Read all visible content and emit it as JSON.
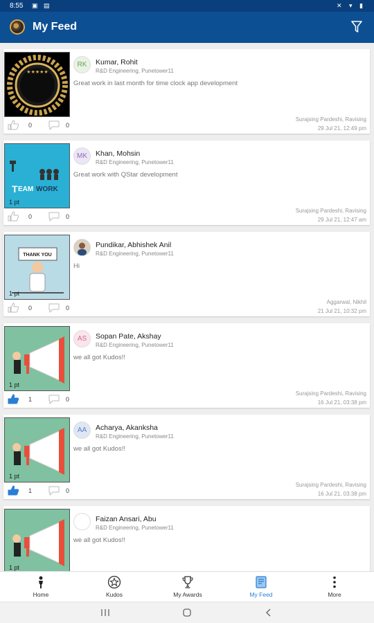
{
  "status_bar": {
    "time": "8:55"
  },
  "app_bar": {
    "title": "My Feed"
  },
  "feed": [
    {
      "points": "",
      "initials": "RK",
      "avatar_bg": "#e9f3e4",
      "avatar_fg": "#6aa05a",
      "name": "Kumar, Rohit",
      "dept": "R&D Engineering, Punetower11",
      "message": "Great work in last month for time clock app development",
      "giver": "Surajsing Pardeshi, Ravising",
      "date": "29 Jul 21, 12:49 pm",
      "likes": "0",
      "comments": "0",
      "liked": false,
      "image": "medal"
    },
    {
      "points": "1 pt",
      "initials": "MK",
      "avatar_bg": "#ece6f5",
      "avatar_fg": "#8c6bbd",
      "name": "Khan, Mohsin",
      "dept": "R&D Engineering, Punetower11",
      "message": "Great work with QStar development",
      "giver": "Surajsing Pardeshi, Ravising",
      "date": "29 Jul 21, 12:47 am",
      "likes": "0",
      "comments": "0",
      "liked": false,
      "image": "teamwork"
    },
    {
      "points": "1 pt",
      "initials": "",
      "avatar_bg": "#c9a27a",
      "avatar_fg": "#fff",
      "name": "Pundikar, Abhishek Anil",
      "dept": "R&D Engineering, Punetower11",
      "message": "Hi",
      "giver": "Aggarwal, Nikhil",
      "date": "21 Jul 21, 10:32 pm",
      "likes": "0",
      "comments": "0",
      "liked": false,
      "image": "thankyou"
    },
    {
      "points": "1 pt",
      "initials": "AS",
      "avatar_bg": "#fbe5ec",
      "avatar_fg": "#d06a8c",
      "name": "Sopan Pate, Akshay",
      "dept": "R&D Engineering, Punetower11",
      "message": "we all got Kudos!!",
      "giver": "Surajsing Pardeshi, Ravising",
      "date": "16 Jul 21, 03:38 pm",
      "likes": "1",
      "comments": "0",
      "liked": true,
      "image": "megaphone"
    },
    {
      "points": "1 pt",
      "initials": "AA",
      "avatar_bg": "#dfe7f5",
      "avatar_fg": "#5b7fc0",
      "name": "Acharya, Akanksha",
      "dept": "R&D Engineering, Punetower11",
      "message": "we all got Kudos!!",
      "giver": "Surajsing Pardeshi, Ravising",
      "date": "16 Jul 21, 03:38 pm",
      "likes": "1",
      "comments": "0",
      "liked": true,
      "image": "megaphone"
    },
    {
      "points": "1 pt",
      "initials": "",
      "avatar_bg": "#ffffff",
      "avatar_fg": "#999",
      "name": "Faizan Ansari, Abu",
      "dept": "R&D Engineering, Punetower11",
      "message": "we all got Kudos!!",
      "giver": "",
      "date": "",
      "likes": "",
      "comments": "",
      "liked": false,
      "image": "megaphone"
    }
  ],
  "bottom_nav": [
    {
      "label": "Home",
      "icon": "person-icon",
      "active": false
    },
    {
      "label": "Kudos",
      "icon": "star-badge-icon",
      "active": false
    },
    {
      "label": "My Awards",
      "icon": "trophy-icon",
      "active": false
    },
    {
      "label": "My Feed",
      "icon": "feed-icon",
      "active": true
    },
    {
      "label": "More",
      "icon": "more-vertical-icon",
      "active": false
    }
  ],
  "colors": {
    "app_bar": "#0d4f93",
    "status_bar": "#0a3f7d",
    "accent": "#2a7fd4",
    "like_active": "#2a7fd4"
  }
}
